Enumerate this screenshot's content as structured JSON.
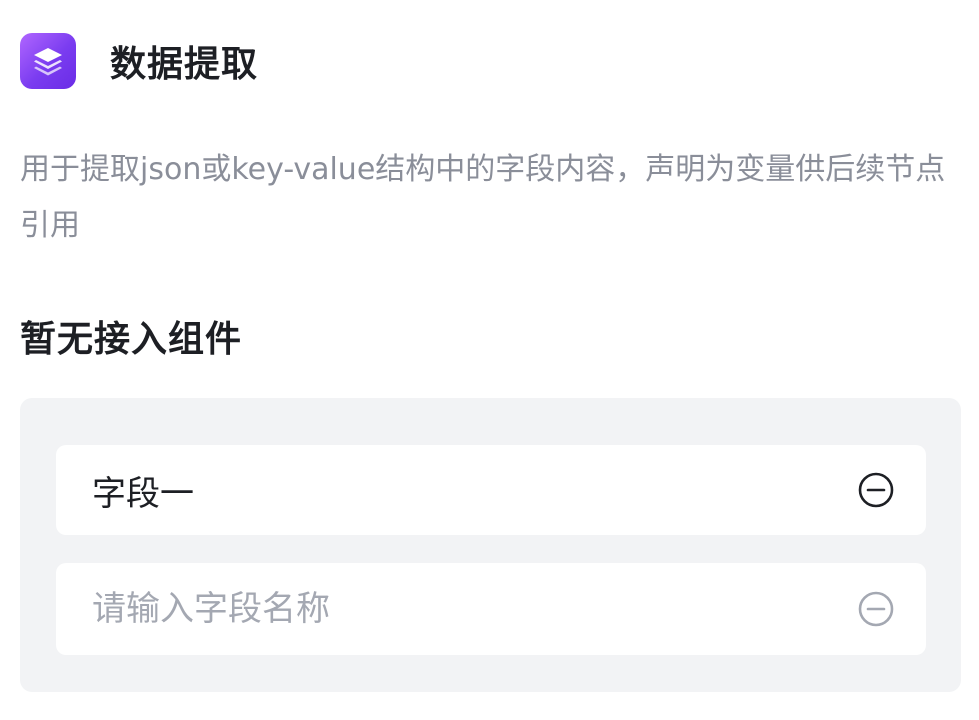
{
  "header": {
    "title": "数据提取",
    "icon": "stacked-layers-icon",
    "icon_gradient": [
      "#b066ff",
      "#6a2ce6"
    ]
  },
  "description": "用于提取json或key-value结构中的字段内容，声明为变量供后续节点引用",
  "section": {
    "title": "暂无接入组件"
  },
  "fields": [
    {
      "value": "字段一",
      "remove_icon": "minus-circle-icon",
      "icon_color": "#1d1f24"
    },
    {
      "value": "",
      "placeholder": "请输入字段名称",
      "remove_icon": "minus-circle-icon",
      "icon_color": "#a4a8b2"
    }
  ]
}
